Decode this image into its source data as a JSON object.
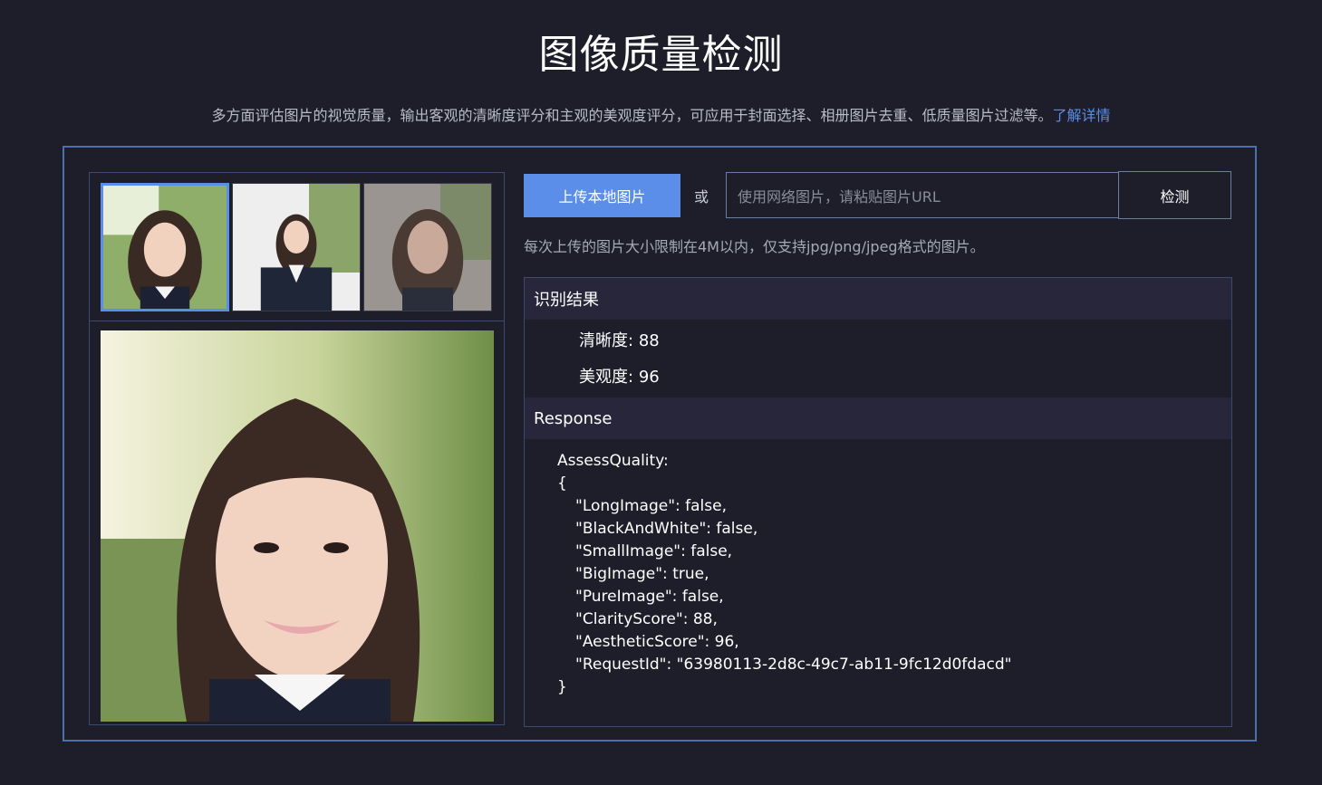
{
  "header": {
    "title": "图像质量检测",
    "subtitle": "多方面评估图片的视觉质量，输出客观的清晰度评分和主观的美观度评分，可应用于封面选择、相册图片去重、低质量图片过滤等。",
    "learn_more": "了解详情"
  },
  "toolbar": {
    "upload_label": "上传本地图片",
    "or_label": "或",
    "url_placeholder": "使用网络图片，请粘贴图片URL",
    "detect_label": "检测",
    "hint": "每次上传的图片大小限制在4M以内，仅支持jpg/png/jpeg格式的图片。"
  },
  "thumbnails": [
    {
      "selected": true
    },
    {
      "selected": false
    },
    {
      "selected": false
    }
  ],
  "result": {
    "section_title": "识别结果",
    "clarity_label": "清晰度:",
    "clarity_value": "88",
    "aesthetic_label": "美观度:",
    "aesthetic_value": "96"
  },
  "response": {
    "section_title": "Response",
    "lines": [
      "AssessQuality:",
      "{",
      "\"LongImage\": false,",
      "\"BlackAndWhite\": false,",
      "\"SmallImage\": false,",
      "\"BigImage\": true,",
      "\"PureImage\": false,",
      "\"ClarityScore\": 88,",
      "\"AestheticScore\": 96,",
      "\"RequestId\": \"63980113-2d8c-49c7-ab11-9fc12d0fdacd\"",
      "}"
    ]
  },
  "colors": {
    "accent": "#5b8ee8",
    "background": "#1e1e2b",
    "border": "#4d6fae"
  }
}
